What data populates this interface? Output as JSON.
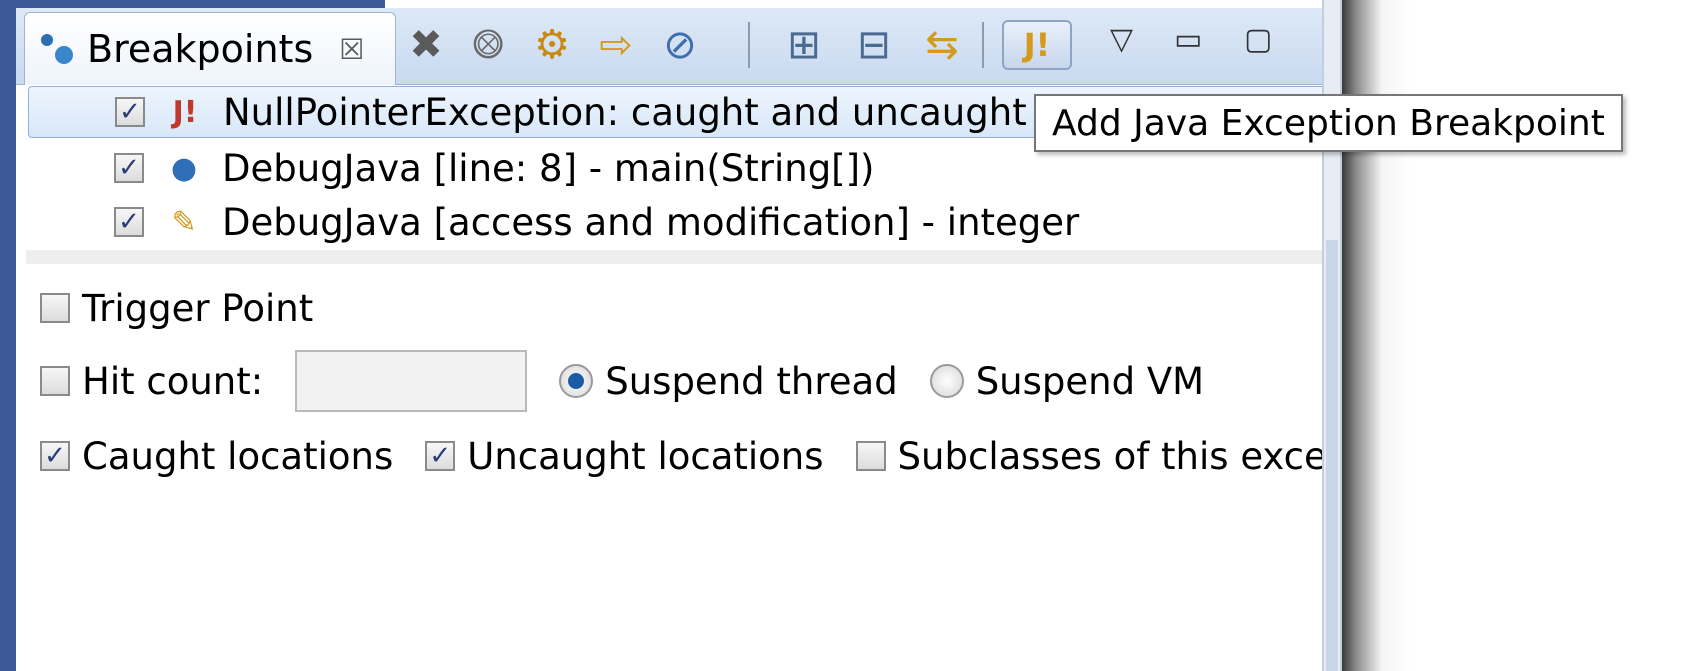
{
  "tab": {
    "label": "Breakpoints",
    "close_glyph": "☒",
    "icon": "breakpoints-view-icon"
  },
  "toolbar": {
    "remove": "✖",
    "remove_all": "⨷",
    "link": "⚙",
    "import": "⇨",
    "skip": "⊘",
    "expand": "⊞",
    "collapse": "⊟",
    "link_editor": "⇆",
    "exception_bp": "J!",
    "menu": "▽",
    "minimize": "▭",
    "maximize": "▢",
    "exception_bp_active": true
  },
  "tooltip": "Add Java Exception Breakpoint",
  "breakpoints": [
    {
      "label": "NullPointerException: caught and uncaught",
      "checked": true,
      "selected": true,
      "icon": "exception-breakpoint-icon",
      "glyph": "J!"
    },
    {
      "label": "DebugJava [line: 8] - main(String[])",
      "checked": true,
      "selected": false,
      "icon": "line-breakpoint-icon",
      "glyph": "●"
    },
    {
      "label": "DebugJava [access and modification] - integer",
      "checked": true,
      "selected": false,
      "icon": "watchpoint-icon",
      "glyph": "✎"
    }
  ],
  "detail": {
    "trigger_point": {
      "label": "Trigger Point",
      "checked": false
    },
    "hit_count": {
      "label": "Hit count:",
      "checked": false,
      "value": ""
    },
    "suspend_thread": {
      "label": "Suspend thread",
      "selected": true
    },
    "suspend_vm": {
      "label": "Suspend VM",
      "selected": false
    },
    "caught": {
      "label": "Caught locations",
      "checked": true
    },
    "uncaught": {
      "label": "Uncaught locations",
      "checked": true
    },
    "subclasses": {
      "label": "Subclasses of this exception",
      "checked": false
    }
  },
  "colors": {
    "frame": "#3c5a98",
    "selection": "#d7e7f9",
    "radio_dot": "#1b5aa6"
  }
}
